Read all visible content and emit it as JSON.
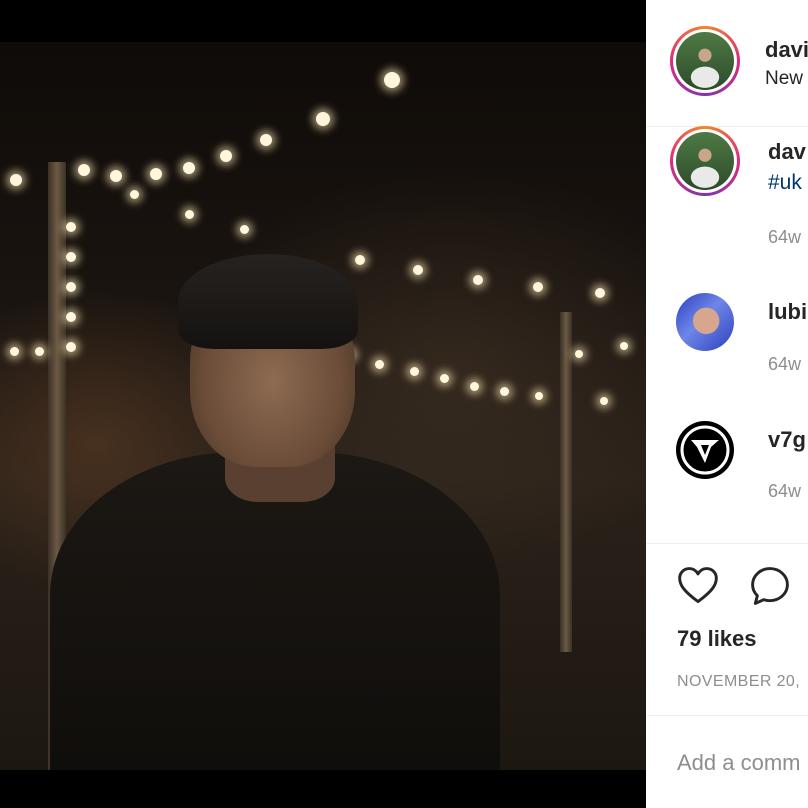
{
  "post": {
    "author": {
      "username": "davi",
      "location": "New"
    },
    "caption": {
      "username": "dav",
      "hashtag": "#uk",
      "time": "64w"
    },
    "comments": [
      {
        "username": "lubi",
        "time": "64w",
        "avatar": "avatar-blue-hair"
      },
      {
        "username": "v7g",
        "time": "64w",
        "avatar": "avatar-v7-logo"
      }
    ],
    "likes": "79 likes",
    "date": "NOVEMBER 20,",
    "comment_placeholder": "Add a comm"
  },
  "icons": {
    "like": "heart-icon",
    "comment": "comment-bubble-icon"
  },
  "colors": {
    "text": "#262626",
    "muted": "#8e8e8e",
    "hashtag": "#00376b",
    "divider": "#efefef"
  }
}
